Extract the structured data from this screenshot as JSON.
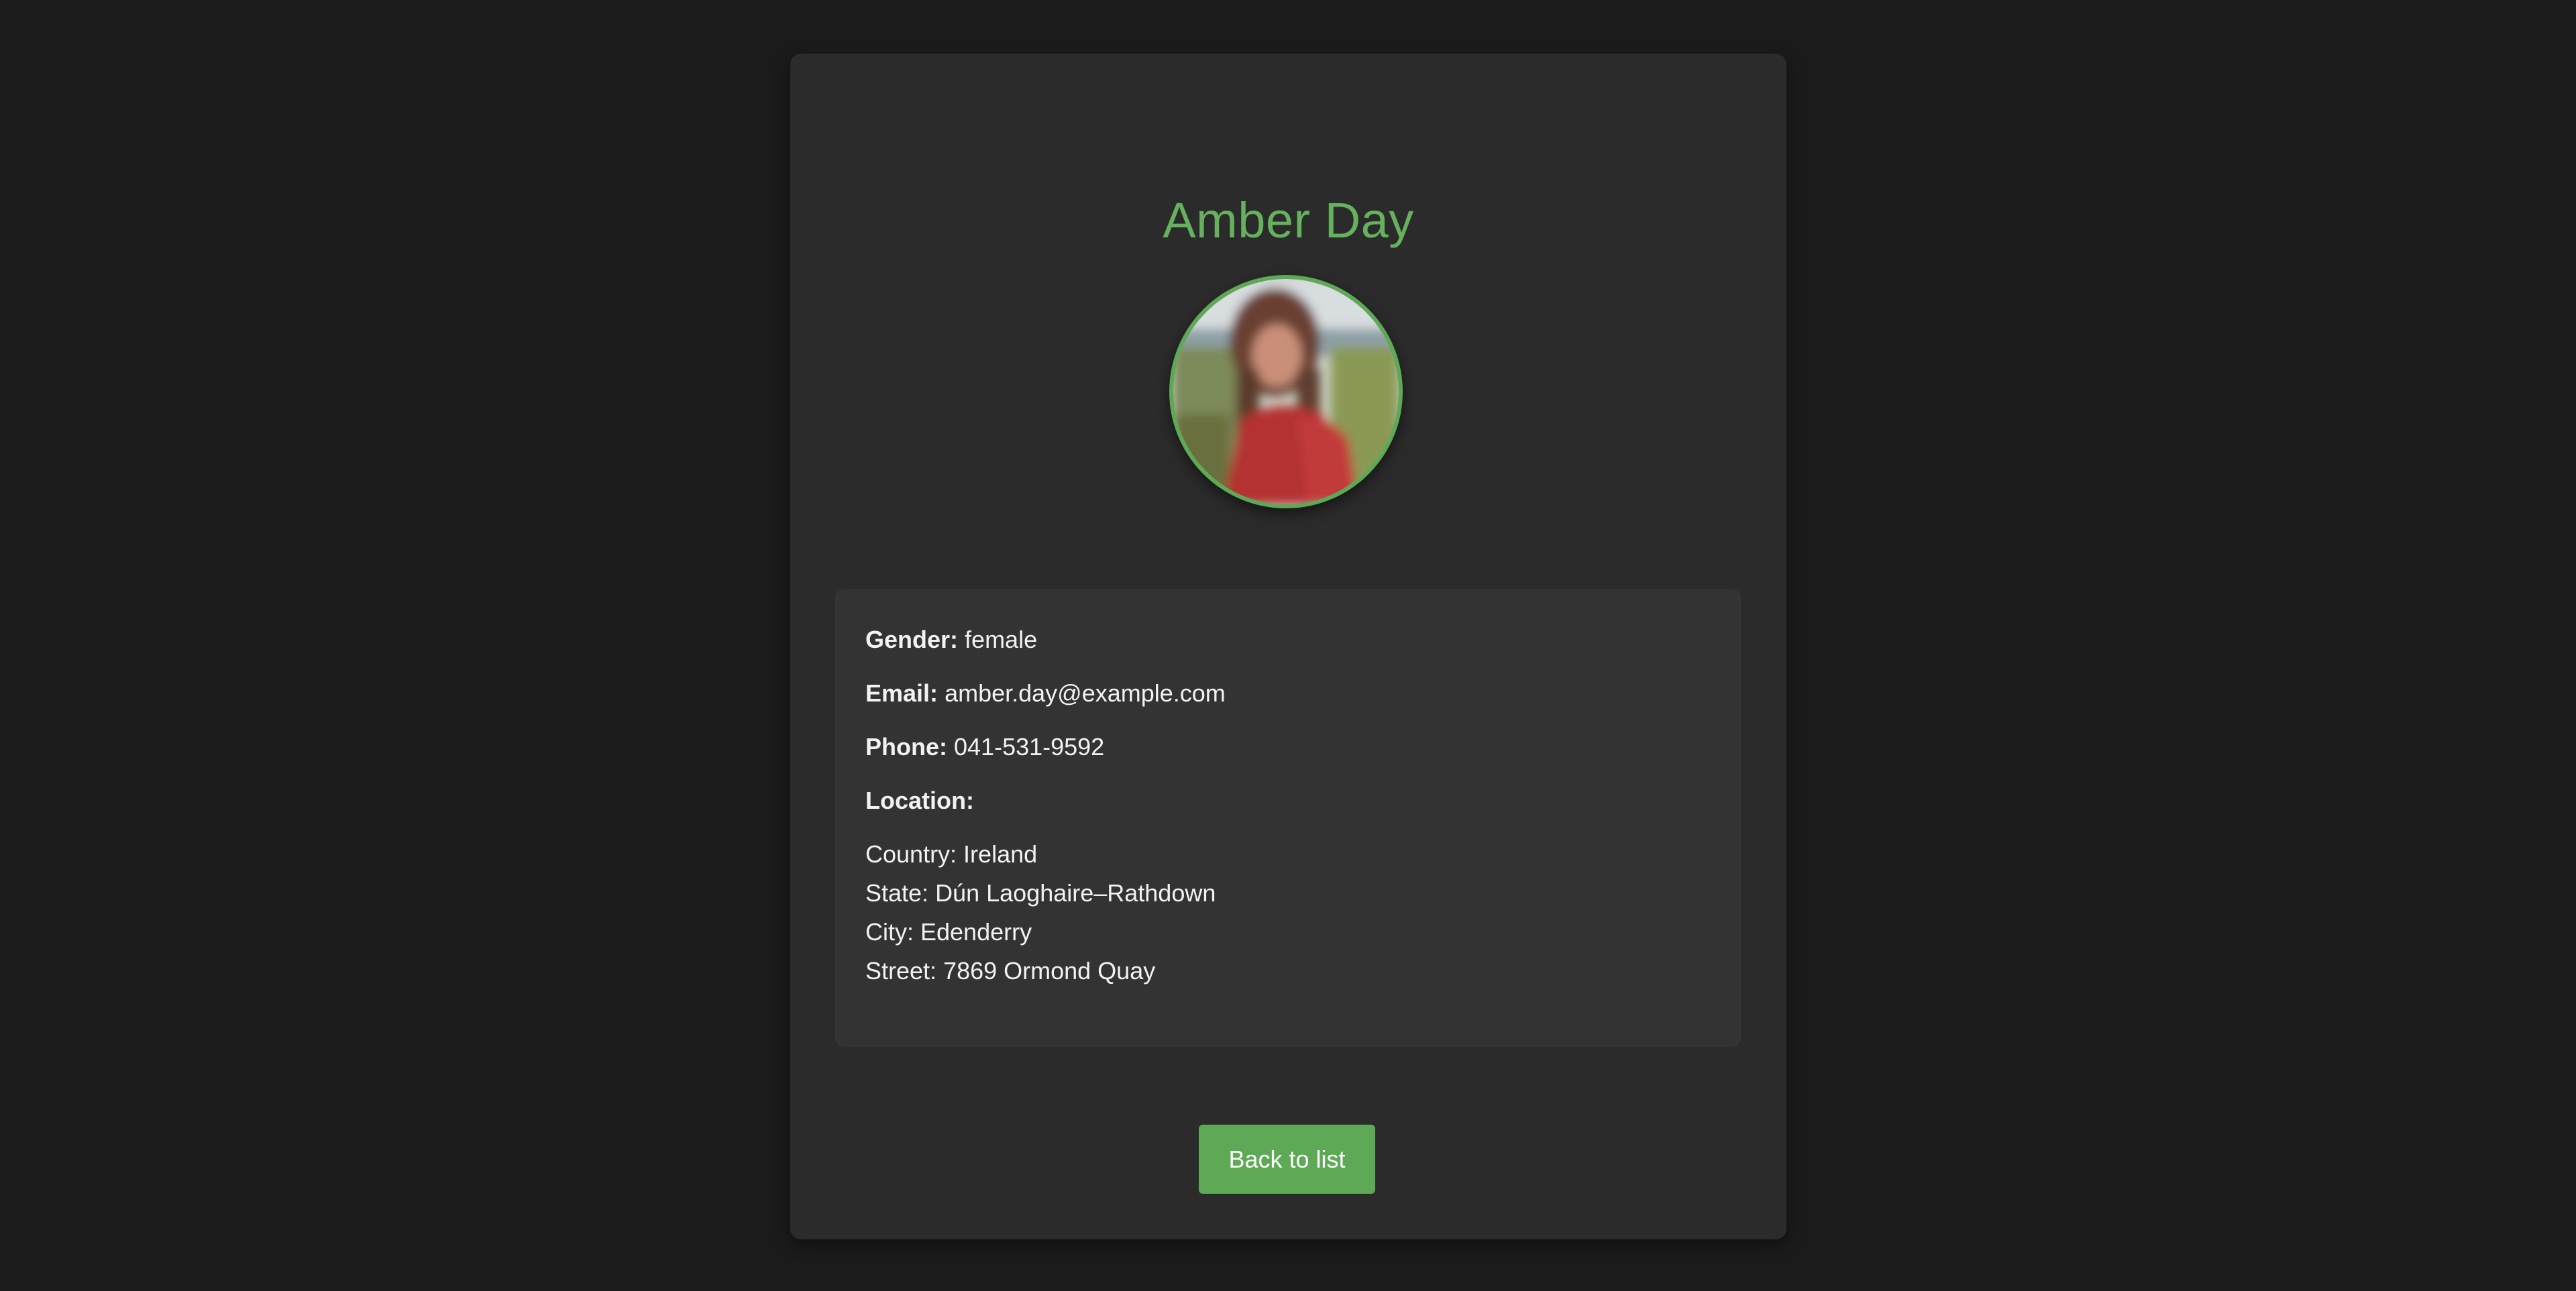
{
  "profile": {
    "name": "Amber Day",
    "avatar_alt": "Amber Day"
  },
  "details": {
    "gender_label": "Gender:",
    "gender": "female",
    "email_label": "Email:",
    "email": "amber.day@example.com",
    "phone_label": "Phone:",
    "phone": "041-531-9592",
    "location_label": "Location:",
    "country": "Country: Ireland",
    "state": "State: Dún Laoghaire–Rathdown",
    "city": "City: Edenderry",
    "street": "Street: 7869 Ormond Quay"
  },
  "actions": {
    "back_label": "Back to list"
  },
  "colors": {
    "background": "#1b1b1b",
    "card": "#2b2b2b",
    "panel": "#333333",
    "accent": "#5ea956",
    "title": "#66b15e"
  }
}
